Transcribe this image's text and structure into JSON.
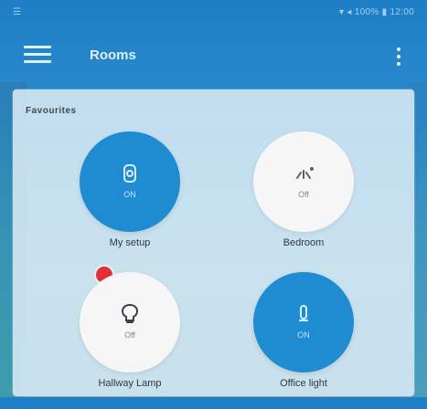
{
  "status": {
    "left": "☰",
    "right": "▾ ◂ 100% ▮ 12:00"
  },
  "appbar": {
    "title": "Rooms"
  },
  "section": {
    "title": "Favourites"
  },
  "devices": [
    {
      "name": "My setup",
      "state": "ON",
      "on": true,
      "icon": "plug-icon",
      "badge": false
    },
    {
      "name": "Bedroom",
      "state": "Off",
      "on": false,
      "icon": "fan-icon",
      "badge": false
    },
    {
      "name": "Hallway Lamp",
      "state": "Off",
      "on": false,
      "icon": "bulb-icon",
      "badge": true
    },
    {
      "name": "Office light",
      "state": "ON",
      "on": true,
      "icon": "light-icon",
      "badge": false
    }
  ],
  "colors": {
    "accent": "#1f8bd1",
    "badge": "#e32d38",
    "panel": "#dcecf5"
  }
}
